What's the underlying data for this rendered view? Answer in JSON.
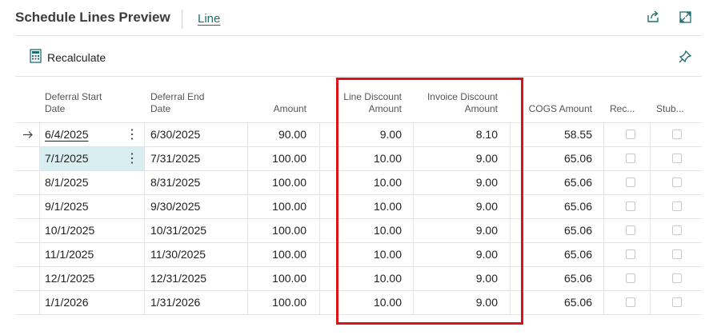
{
  "header": {
    "title": "Schedule Lines Preview",
    "tab_line": "Line"
  },
  "actions": {
    "recalculate": "Recalculate"
  },
  "columns": {
    "deferral_start_1": "Deferral Start",
    "deferral_start_2": "Date",
    "deferral_end_1": "Deferral End",
    "deferral_end_2": "Date",
    "amount": "Amount",
    "line_discount_1": "Line Discount",
    "line_discount_2": "Amount",
    "invoice_discount_1": "Invoice Discount",
    "invoice_discount_2": "Amount",
    "cogs": "COGS Amount",
    "rec": "Rec...",
    "stub": "Stub..."
  },
  "rows": [
    {
      "start": "6/4/2025",
      "end": "6/30/2025",
      "amount": "90.00",
      "line_disc": "9.00",
      "inv_disc": "8.10",
      "cogs": "58.55"
    },
    {
      "start": "7/1/2025",
      "end": "7/31/2025",
      "amount": "100.00",
      "line_disc": "10.00",
      "inv_disc": "9.00",
      "cogs": "65.06"
    },
    {
      "start": "8/1/2025",
      "end": "8/31/2025",
      "amount": "100.00",
      "line_disc": "10.00",
      "inv_disc": "9.00",
      "cogs": "65.06"
    },
    {
      "start": "9/1/2025",
      "end": "9/30/2025",
      "amount": "100.00",
      "line_disc": "10.00",
      "inv_disc": "9.00",
      "cogs": "65.06"
    },
    {
      "start": "10/1/2025",
      "end": "10/31/2025",
      "amount": "100.00",
      "line_disc": "10.00",
      "inv_disc": "9.00",
      "cogs": "65.06"
    },
    {
      "start": "11/1/2025",
      "end": "11/30/2025",
      "amount": "100.00",
      "line_disc": "10.00",
      "inv_disc": "9.00",
      "cogs": "65.06"
    },
    {
      "start": "12/1/2025",
      "end": "12/31/2025",
      "amount": "100.00",
      "line_disc": "10.00",
      "inv_disc": "9.00",
      "cogs": "65.06"
    },
    {
      "start": "1/1/2026",
      "end": "1/31/2026",
      "amount": "100.00",
      "line_disc": "10.00",
      "inv_disc": "9.00",
      "cogs": "65.06"
    }
  ],
  "icons": {
    "share": "share-icon",
    "expand": "expand-icon",
    "pin": "pin-icon",
    "recalc": "calculator-icon",
    "row_pointer": "arrow-right-icon",
    "row_menu": "more-vertical-icon"
  },
  "colors": {
    "accent": "#1f6e6e",
    "selection": "#d8eef0",
    "highlight_box": "#d9131a"
  }
}
